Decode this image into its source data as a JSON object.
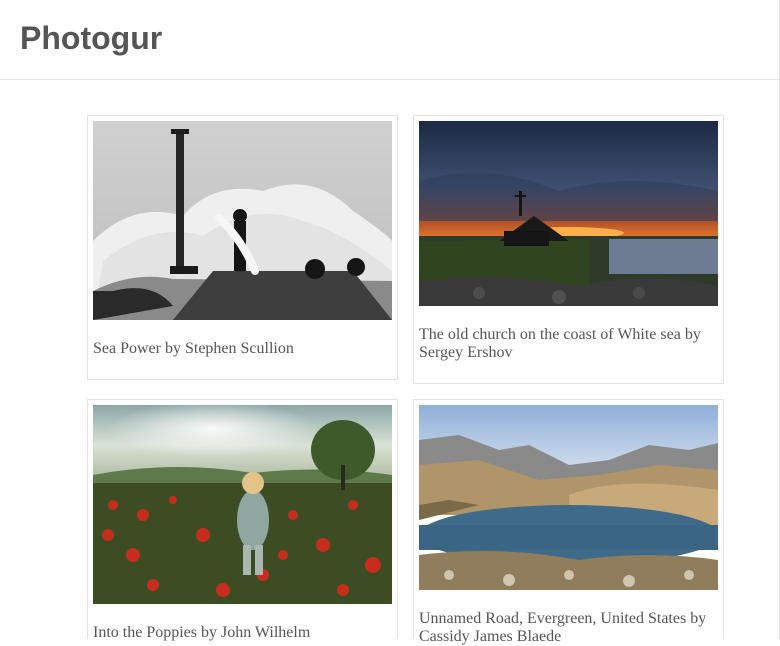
{
  "app": {
    "brand": "Photogur"
  },
  "photos": [
    {
      "caption": "Sea Power by Stephen Scullion"
    },
    {
      "caption": "The old church on the coast of White sea by Sergey Ershov"
    },
    {
      "caption": "Into the Poppies by John Wilhelm"
    },
    {
      "caption": "Unnamed Road, Evergreen, United States by Cassidy James Blaede"
    }
  ],
  "colors": {
    "brand_text": "#555555",
    "caption_text": "#555555",
    "card_border": "#e3e3e3"
  }
}
